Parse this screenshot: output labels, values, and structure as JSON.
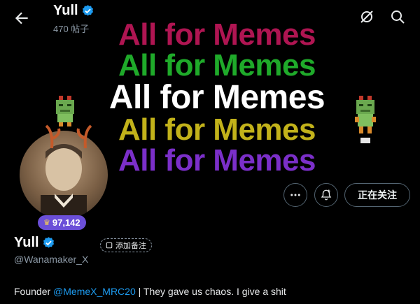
{
  "header": {
    "title": "Yull",
    "post_count": "470 帖子",
    "icons": [
      "back-arrow-icon",
      "verified-icon",
      "no-notification-icon",
      "search-icon"
    ]
  },
  "banner": {
    "lines": [
      {
        "text": "All for Memes",
        "color": "#c2185b"
      },
      {
        "text": "All for Memes",
        "color": "#1faa2a"
      },
      {
        "text": "All for Memes",
        "color": "#ffffff"
      },
      {
        "text": "All for Memes",
        "color": "#c2b21a"
      },
      {
        "text": "All for Memes",
        "color": "#7b2fc9"
      }
    ]
  },
  "profile": {
    "badge": "97,142",
    "name": "Yull",
    "handle": "@Wanamaker_X",
    "note_label": "添加备注",
    "follow_label": "正在关注",
    "bio_prefix": "Founder ",
    "bio_mention": "@MemeX_MRC20",
    "bio_suffix": " | They gave us chaos. I give a shit"
  },
  "colors": {
    "accent": "#1d9bf0",
    "badge": "#6b4fd8",
    "background": "#000000"
  }
}
